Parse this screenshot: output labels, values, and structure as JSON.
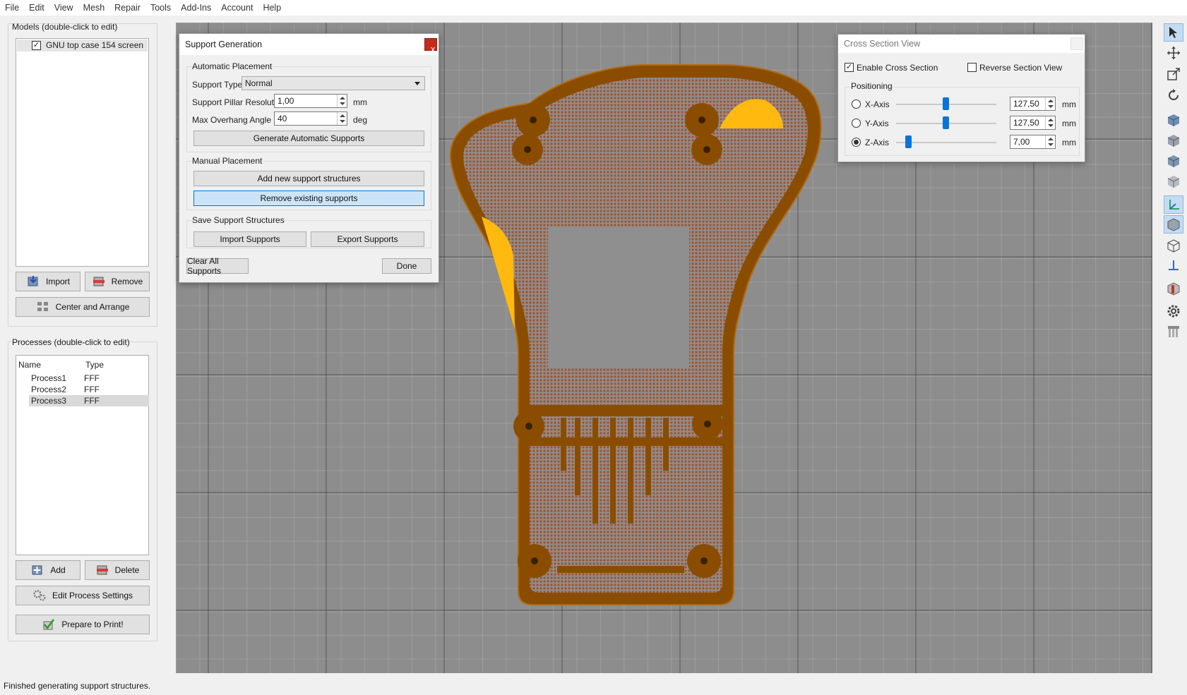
{
  "menu": [
    "File",
    "Edit",
    "View",
    "Mesh",
    "Repair",
    "Tools",
    "Add-Ins",
    "Account",
    "Help"
  ],
  "models": {
    "title": "Models (double-click to edit)",
    "items": [
      {
        "label": "GNU top case 154 screen",
        "checked": true
      }
    ],
    "import_label": "Import",
    "remove_label": "Remove",
    "center_label": "Center and Arrange"
  },
  "processes": {
    "title": "Processes (double-click to edit)",
    "col_name": "Name",
    "col_type": "Type",
    "rows": [
      {
        "name": "Process1",
        "type": "FFF"
      },
      {
        "name": "Process2",
        "type": "FFF"
      },
      {
        "name": "Process3",
        "type": "FFF"
      }
    ],
    "add_label": "Add",
    "delete_label": "Delete",
    "edit_label": "Edit Process Settings",
    "prepare_label": "Prepare to Print!"
  },
  "support_dialog": {
    "title": "Support Generation",
    "close": "x",
    "auto_group": "Automatic Placement",
    "support_type_label": "Support Type",
    "support_type_value": "Normal",
    "pillar_label": "Support Pillar Resolution",
    "pillar_value": "1,00",
    "pillar_unit": "mm",
    "overhang_label": "Max Overhang Angle",
    "overhang_value": "40",
    "overhang_unit": "deg",
    "generate_label": "Generate Automatic Supports",
    "manual_group": "Manual Placement",
    "add_label": "Add new support structures",
    "remove_label": "Remove existing supports",
    "save_group": "Save Support Structures",
    "import_label": "Import Supports",
    "export_label": "Export Supports",
    "clear_label": "Clear All Supports",
    "done_label": "Done"
  },
  "cross_section": {
    "title": "Cross Section View",
    "enable_label": "Enable Cross Section",
    "enable_checked": true,
    "reverse_label": "Reverse Section View",
    "reverse_checked": false,
    "positioning_label": "Positioning",
    "axes": [
      {
        "label": "X-Axis",
        "value": "127,50",
        "unit": "mm",
        "selected": false,
        "level": 0.5
      },
      {
        "label": "Y-Axis",
        "value": "127,50",
        "unit": "mm",
        "selected": false,
        "level": 0.5
      },
      {
        "label": "Z-Axis",
        "value": "7,00",
        "unit": "mm",
        "selected": true,
        "level": 0.12
      }
    ]
  },
  "toolbar_icons": [
    "select-arrow-icon",
    "move-icon",
    "scale-icon",
    "rotate-icon",
    "view-front-icon",
    "view-back-icon",
    "view-left-icon",
    "view-right-icon",
    "axes-icon",
    "solid-view-icon",
    "wireframe-view-icon",
    "normal-axis-icon",
    "section-icon",
    "settings-gear-icon",
    "supports-icon"
  ],
  "status_text": "Finished generating support structures.",
  "colors": {
    "model_brown": "#8a4d00",
    "overhang_yellow": "#ffb90f",
    "accent_blue": "#0a74d6"
  }
}
